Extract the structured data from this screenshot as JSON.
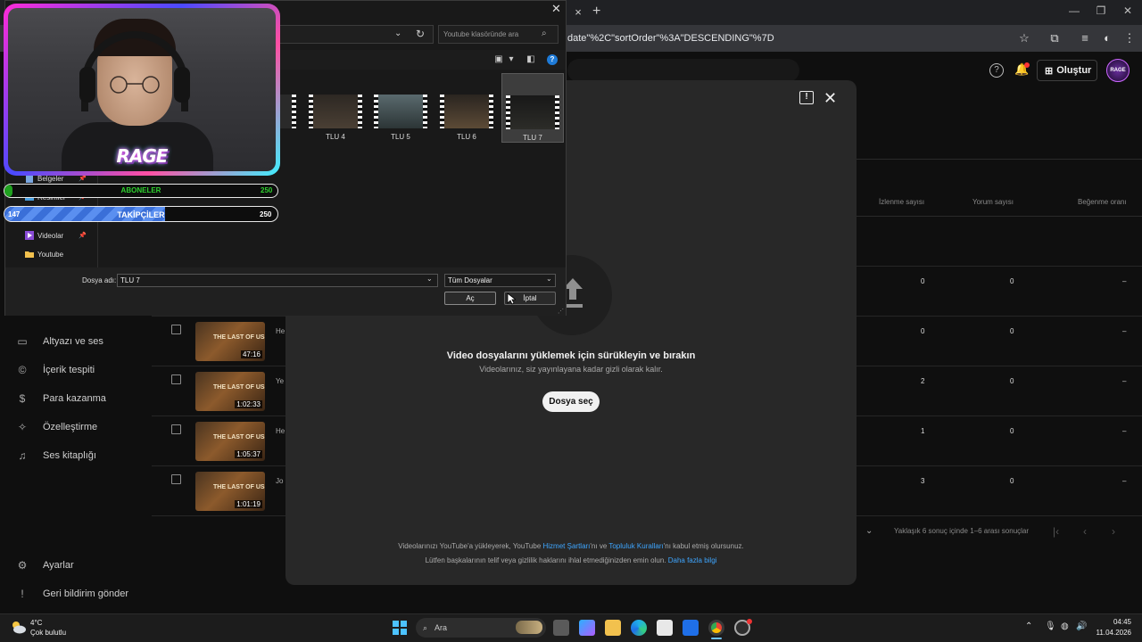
{
  "browser": {
    "url_fragment": "date\"%2C\"sortOrder\"%3A\"DESCENDING\"%7D",
    "tab_close": "×",
    "new_tab": "+"
  },
  "studio": {
    "create_label": "Oluştur",
    "sidebar": [
      {
        "label": "Altyazı ve ses",
        "icon": "subtitles-icon"
      },
      {
        "label": "İçerik tespiti",
        "icon": "copyright-icon"
      },
      {
        "label": "Para kazanma",
        "icon": "dollar-icon"
      },
      {
        "label": "Özelleştirme",
        "icon": "magic-wand-icon"
      },
      {
        "label": "Ses kitaplığı",
        "icon": "audio-library-icon"
      }
    ],
    "sidebar_bottom": [
      {
        "label": "Ayarlar",
        "icon": "settings-icon"
      },
      {
        "label": "Geri bildirim gönder",
        "icon": "feedback-icon"
      }
    ],
    "columns": [
      "İzlenme sayısı",
      "Yorum sayısı",
      "Beğenme oranı"
    ],
    "rows": [
      {
        "title_stub": "",
        "duration": "",
        "views": "0",
        "comments": "0",
        "likes": "–"
      },
      {
        "title_stub": "He",
        "duration": "47:16",
        "views": "0",
        "comments": "0",
        "likes": "–"
      },
      {
        "title_stub": "Ye",
        "duration": "1:02:33",
        "views": "2",
        "comments": "0",
        "likes": "–"
      },
      {
        "title_stub": "He",
        "duration": "1:05:37",
        "views": "1",
        "comments": "0",
        "likes": "–"
      },
      {
        "title_stub": "Jo",
        "duration": "1:01:19",
        "views": "3",
        "comments": "0",
        "likes": "–"
      }
    ],
    "thumb_text": "THE LAST OF US",
    "pager_text": "Yaklaşık 6 sonuç içinde 1–6 arası sonuçlar"
  },
  "upload": {
    "title": "Video dosyalarını yüklemek için sürükleyin ve bırakın",
    "subtitle": "Videolarınız, siz yayınlayana kadar gizli olarak kalır.",
    "button": "Dosya seç",
    "terms_a": "Videolarınızı YouTube'a yükleyerek, YouTube ",
    "terms_link1": "Hizmet Şartları",
    "terms_b": "'nı ve ",
    "terms_link2": "Topluluk Kuralları",
    "terms_c": "'nı kabul etmiş olursunuz.",
    "terms2_a": "Lütfen başkalarının telif veya gizlilik haklarını ihlal etmediğinizden emin olun. ",
    "terms2_link": "Daha fazla bilgi"
  },
  "dialog": {
    "title": "Aç",
    "search_placeholder": "Youtube klasöründe ara",
    "nav": [
      {
        "label": "Belgeler",
        "pinned": true
      },
      {
        "label": "Resimler",
        "pinned": true
      },
      {
        "label": "Videolar",
        "pinned": true
      },
      {
        "label": "Youtube",
        "pinned": false
      }
    ],
    "files": [
      "TLU 4",
      "TLU 5",
      "TLU 6",
      "TLU 7"
    ],
    "filename_label": "Dosya adı:",
    "filename_value": "TLU 7",
    "filetype_value": "Tüm Dosyalar",
    "open_label": "Aç",
    "cancel_label": "İptal"
  },
  "overlay": {
    "logo": "RAGE",
    "subs_label": "ABONELER",
    "subs_count": "250",
    "subs_progress": 0.03,
    "follow_label": "TAKİPÇİLER",
    "follow_current": "147",
    "follow_goal": "250",
    "follow_progress": 0.588
  },
  "taskbar": {
    "temp": "4°C",
    "weather": "Çok bulutlu",
    "search": "Ara",
    "time": "04:45",
    "date": "11.04.2026"
  }
}
